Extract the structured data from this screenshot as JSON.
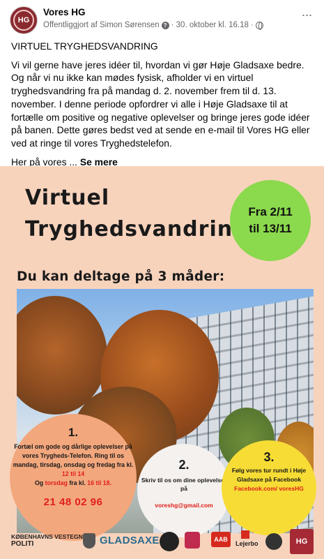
{
  "header": {
    "author": "Vores HG",
    "avatar_text": "HG",
    "meta_prefix": "Offentliggjort af Simon Sørensen",
    "meta_date": "· 30. oktober kl. 16.18 ·",
    "more_label": "···"
  },
  "post": {
    "headline": "VIRTUEL TRYGHEDSVANDRING",
    "body": "Vi vil gerne have jeres idéer til, hvordan vi gør Høje Gladsaxe bedre. Og når vi nu ikke kan mødes fysisk, afholder vi en virtuel tryghedsvandring fra på mandag d. 2. november frem til d. 13. november. I denne periode opfordrer vi alle i Høje Gladsaxe til at fortælle om positive og negative oplevelser og bringe jeres gode idéer på banen. Dette gøres bedst ved at sende en e-mail til Vores HG eller ved at ringe til vores Tryghedstelefon.",
    "teaser": "Her på vores ...",
    "see_more": "Se mere"
  },
  "poster": {
    "title_line1": "Virtuel",
    "title_line2": "Tryghedsvandring",
    "date_line1": "Fra 2/11",
    "date_line2": "til 13/11",
    "subtitle": "Du kan deltage på 3 måder:",
    "option1": {
      "num": "1.",
      "text_a": "Fortæl om gode og dårlige oplevelser på vores Trygheds-Telefon. Ring til os mandag, tirsdag, onsdag og fredag fra kl.",
      "time_a": "12 til 14",
      "text_b": "Og",
      "day_b": "torsdag",
      "text_c": "fra kl.",
      "time_b": "16 til 18.",
      "phone": "21 48 02 96"
    },
    "option2": {
      "num": "2.",
      "text": "Skriv til os om dine oplevelser på",
      "email": "voreshg@gmail.com"
    },
    "option3": {
      "num": "3.",
      "text": "Følg vores tur rundt i Høje Gladsaxe på Facebook",
      "link": "Facebook.com/ voresHG"
    },
    "logos": {
      "police_line1": "KØBENHAVNS VESTEGNS",
      "police_line2": "POLITI",
      "gladsaxe": "GLADSAXE",
      "aab": "AAB",
      "lejerbo": "Lejerbo",
      "hg": "HG"
    }
  },
  "colors": {
    "poster_bg": "#f8d3bc",
    "date_circle": "#8bd94d",
    "option1_circle": "#f3a77d",
    "option2_circle": "#f4f1ee",
    "option3_circle": "#f7dc35",
    "accent_red": "#e0201b"
  }
}
